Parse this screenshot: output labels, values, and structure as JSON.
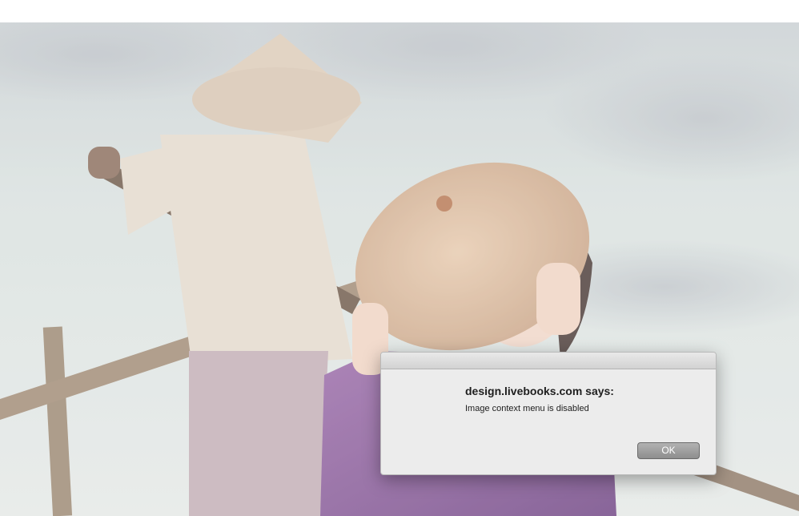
{
  "dialog": {
    "heading": "design.livebooks.com says:",
    "message": "Image context menu is disabled",
    "ok_label": "OK"
  },
  "colors": {
    "sky": "#d3dcdc",
    "dress_purple": "#8a5a9c",
    "hat_tan": "#d6b79c",
    "dialog_bg": "#ececec",
    "button_gray": "#9e9e9e"
  }
}
